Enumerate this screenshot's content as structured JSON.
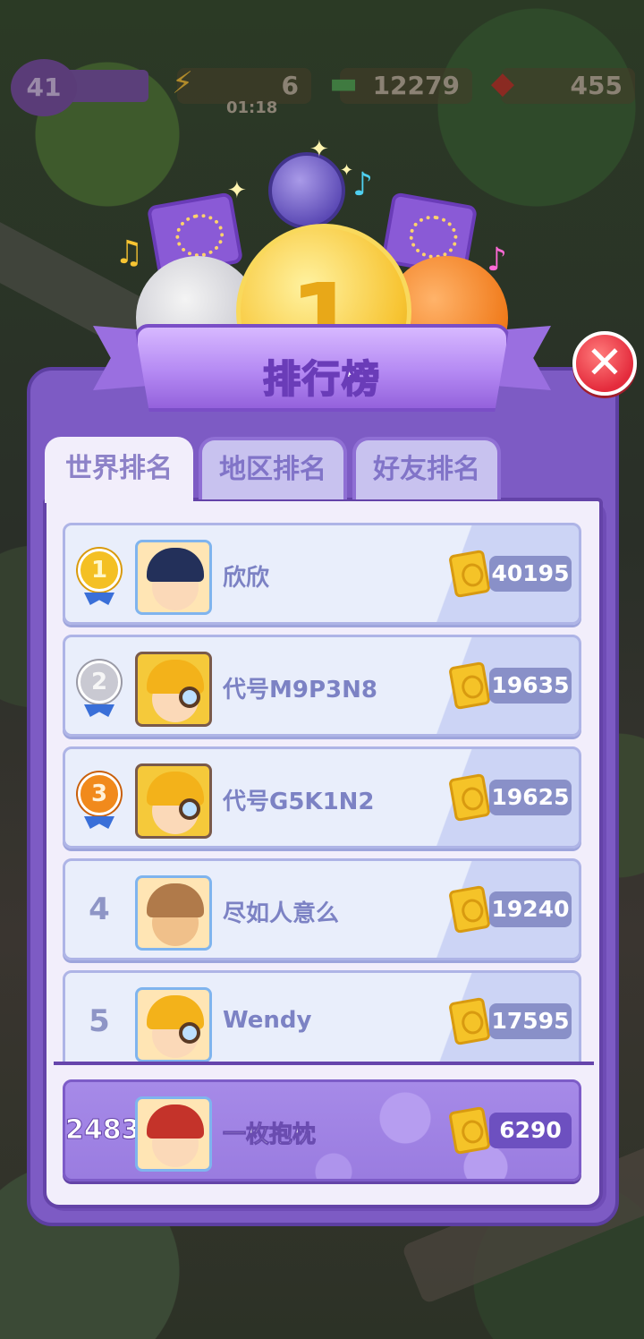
{
  "hud": {
    "level": "41",
    "energy": "6",
    "energy_timer": "01:18",
    "cash": "12279",
    "gems": "455"
  },
  "leaderboard": {
    "title": "排行榜",
    "tabs": [
      {
        "label": "世界排名",
        "active": true
      },
      {
        "label": "地区排名",
        "active": false
      },
      {
        "label": "好友排名",
        "active": false
      }
    ],
    "entries": [
      {
        "rank": "1",
        "name": "欣欣",
        "score": "40195",
        "medal": "gold"
      },
      {
        "rank": "2",
        "name": "代号M9P3N8",
        "score": "19635",
        "medal": "silver"
      },
      {
        "rank": "3",
        "name": "代号G5K1N2",
        "score": "19625",
        "medal": "bronze"
      },
      {
        "rank": "4",
        "name": "尽如人意么",
        "score": "19240",
        "medal": ""
      },
      {
        "rank": "5",
        "name": "Wendy",
        "score": "17595",
        "medal": ""
      }
    ],
    "me": {
      "rank": "2483",
      "name": "一枚抱枕",
      "score": "6290"
    }
  },
  "icons": {
    "close": "close-icon",
    "coin": "ticket-coin-icon",
    "medal": "rank-medal-icon"
  },
  "colors": {
    "panel": "#7d5bc4",
    "accent": "#f7c432",
    "close": "#e42b3c"
  }
}
